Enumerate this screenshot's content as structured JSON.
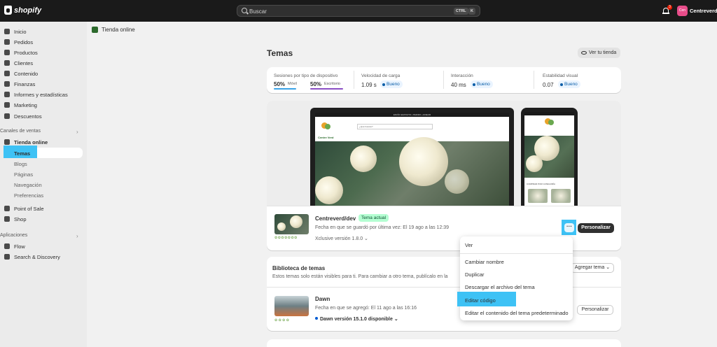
{
  "topbar": {
    "logo_text": "shopify",
    "search_placeholder": "Buscar",
    "kbd_ctrl": "CTRL",
    "kbd_k": "K",
    "notification_count": "3",
    "user_initials": "Cen",
    "user_name": "Centreverd"
  },
  "sidebar": {
    "items": [
      {
        "label": "Inicio",
        "icon": "home-icon"
      },
      {
        "label": "Pedidos",
        "icon": "orders-icon"
      },
      {
        "label": "Productos",
        "icon": "tag-icon"
      },
      {
        "label": "Clientes",
        "icon": "person-icon"
      },
      {
        "label": "Contenido",
        "icon": "content-icon"
      },
      {
        "label": "Finanzas",
        "icon": "bank-icon"
      },
      {
        "label": "Informes y estadísticas",
        "icon": "chart-icon"
      },
      {
        "label": "Marketing",
        "icon": "target-icon"
      },
      {
        "label": "Descuentos",
        "icon": "discount-icon"
      }
    ],
    "sales_channels_label": "Canales de ventas",
    "online_store_label": "Tienda online",
    "online_store_sub": [
      "Temas",
      "Blogs",
      "Páginas",
      "Navegación",
      "Preferencias"
    ],
    "channels_other": [
      "Point of Sale",
      "Shop"
    ],
    "apps_label": "Aplicaciones",
    "apps": [
      "Flow",
      "Search & Discovery"
    ]
  },
  "breadcrumb": {
    "label": "Tienda online"
  },
  "page": {
    "title": "Temas",
    "view_store_label": "Ver tu tienda"
  },
  "metrics": {
    "sessions_label": "Sesiones por tipo de dispositivo",
    "mobile_pct": "50%",
    "mobile_label": "Móvil",
    "desktop_pct": "50%",
    "desktop_label": "Escritorio",
    "speed_label": "Velocidad de carga",
    "speed_value": "1.09 s",
    "speed_status": "Bueno",
    "interaction_label": "Interacción",
    "interaction_value": "40 ms",
    "interaction_status": "Bueno",
    "stability_label": "Estabilidad visual",
    "stability_value": "0.07",
    "stability_status": "Bueno"
  },
  "preview": {
    "laptop_strip_text": "ENVÍO GRATUITO | PEDIDO +100EUR",
    "brand_name": "Centre Verd",
    "search_placeholder": "¿Qué buscas?",
    "phone_section_label": "COMPRAR POR CATEGORÍA"
  },
  "current_theme": {
    "name": "Centreverd/dev",
    "badge": "Tema actual",
    "meta": "Fecha en que se guardó por última vez: El 19 ago a las 12:39",
    "version": "Xclusive versión 1.8.0",
    "more_label": "···",
    "customize_label": "Personalizar"
  },
  "library": {
    "title": "Biblioteca de temas",
    "description": "Estos temas solo están visibles para ti. Para cambiar a otro tema, publícalo en la",
    "add_theme_label": "Agregar tema",
    "themes": [
      {
        "name": "Dawn",
        "meta": "Fecha en que se agregó: El 11 ago a las 16:16",
        "version": "Dawn versión 15.1.0 disponible",
        "customize_label": "Personalizar"
      }
    ]
  },
  "dropdown": {
    "items": [
      "Ver",
      "Cambiar nombre",
      "Duplicar",
      "Descargar el archivo del tema",
      "Editar código",
      "Editar el contenido del tema predeterminado"
    ]
  },
  "colors": {
    "highlight": "#3ec2f5",
    "topbar": "#1a1a1a",
    "badge_current_bg": "#b4fed2",
    "good_badge_fg": "#0a5ea8"
  }
}
